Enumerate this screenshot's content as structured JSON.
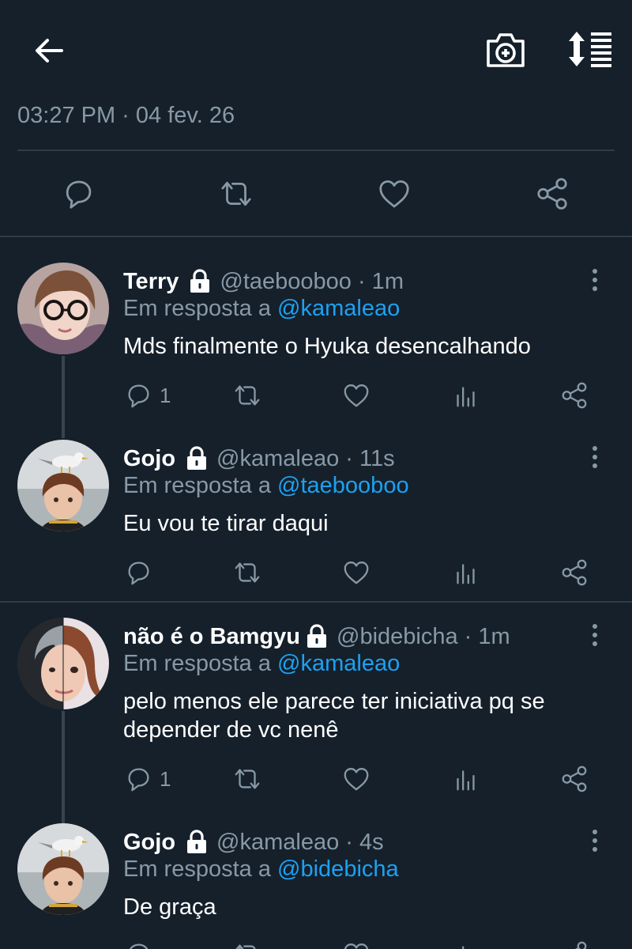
{
  "header": {
    "back_icon": "back-arrow-icon",
    "camera_icon": "camera-add-icon",
    "sort_icon": "sort-list-icon"
  },
  "timestamp": "03:27 PM · 04 fev. 26",
  "main_actions": [
    "reply-icon",
    "retweet-icon",
    "like-icon",
    "share-icon"
  ],
  "tweets": [
    {
      "name": "Terry",
      "handle": "@taebooboo · 1m",
      "reply_prefix": "Em resposta a",
      "reply_to": "@kamaleao",
      "text": "Mds finalmente o Hyuka desencalhando",
      "reply_count": "1",
      "retweet_count": "",
      "like_count": ""
    },
    {
      "name": "Gojo",
      "handle": "@kamaleao · 11s",
      "reply_prefix": "Em resposta a",
      "reply_to": "@taebooboo",
      "text": "Eu vou te tirar daqui",
      "reply_count": "",
      "retweet_count": "",
      "like_count": ""
    },
    {
      "name": "não é o Bamgyu",
      "handle": "@bidebicha · 1m",
      "reply_prefix": "Em resposta a",
      "reply_to": "@kamaleao",
      "text": "pelo menos ele parece ter iniciativa pq se depender de vc nenê",
      "reply_count": "1",
      "retweet_count": "",
      "like_count": ""
    },
    {
      "name": "Gojo",
      "handle": "@kamaleao · 4s",
      "reply_prefix": "Em resposta a",
      "reply_to": "@bidebicha",
      "text": "De graça",
      "reply_count": "",
      "retweet_count": "",
      "like_count": ""
    }
  ],
  "colors": {
    "background": "#15202b",
    "secondary_text": "#8899a6",
    "mention": "#1da1f2",
    "divider": "#2f3b47"
  }
}
